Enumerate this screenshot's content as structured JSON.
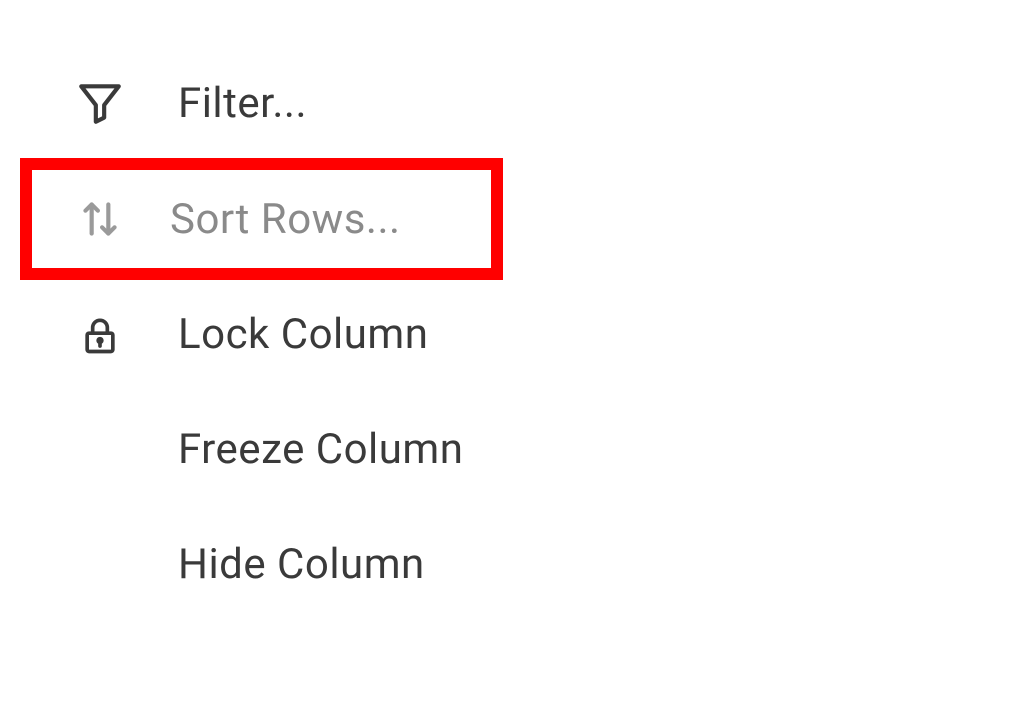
{
  "menu": {
    "items": [
      {
        "label": "Filter...",
        "icon": "funnel",
        "highlighted": false
      },
      {
        "label": "Sort Rows...",
        "icon": "sort",
        "highlighted": true
      },
      {
        "label": "Lock Column",
        "icon": "lock",
        "highlighted": false
      },
      {
        "label": "Freeze Column",
        "icon": null,
        "highlighted": false
      },
      {
        "label": "Hide Column",
        "icon": null,
        "highlighted": false
      }
    ]
  },
  "highlight_color": "#ff0000"
}
